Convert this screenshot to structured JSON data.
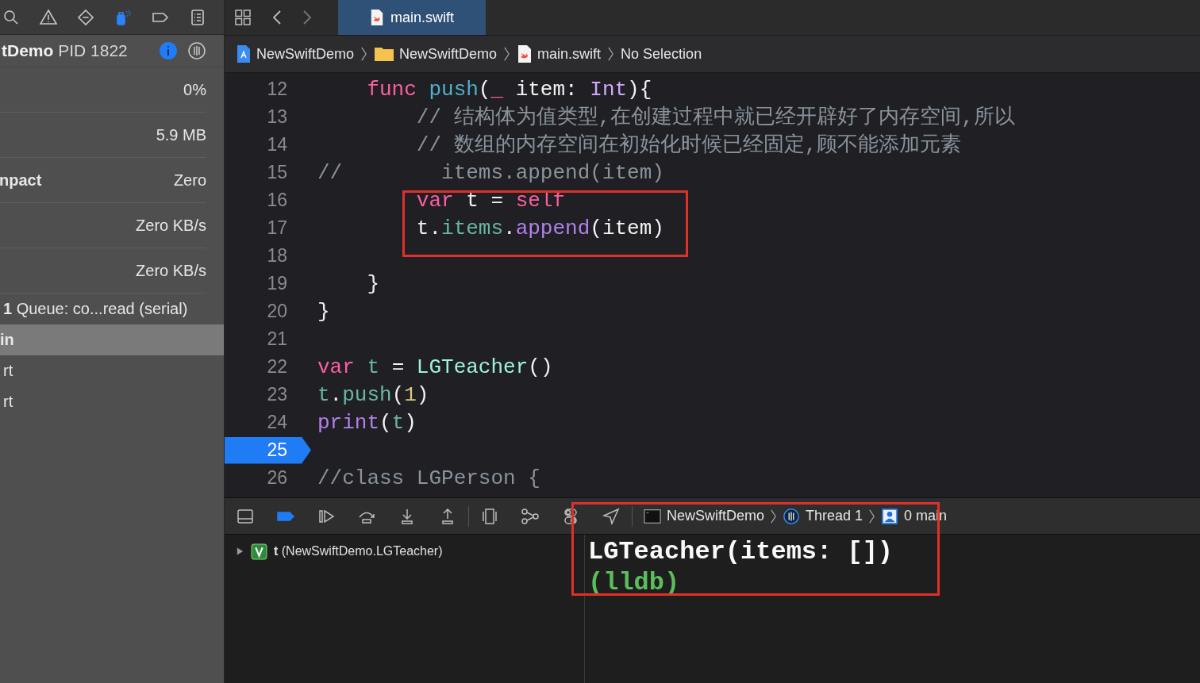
{
  "sidebar": {
    "navigator_tabs": [
      {
        "selected": false
      },
      {
        "selected": false
      },
      {
        "selected": false
      },
      {
        "selected": true
      },
      {
        "selected": false
      },
      {
        "selected": false
      }
    ],
    "process": {
      "name": "tDemo",
      "pid": "PID 1822"
    },
    "gauges": [
      {
        "value": "0%"
      },
      {
        "value": "5.9 MB"
      },
      {
        "label": "npact",
        "value": "Zero"
      },
      {
        "value": "Zero KB/s"
      },
      {
        "value": "Zero KB/s"
      }
    ],
    "threads": [
      {
        "text": "**1** Queue: co...read (serial)",
        "selected": false
      },
      {
        "text": "in",
        "selected": true
      },
      {
        "text": "rt",
        "selected": false
      },
      {
        "text": "rt",
        "selected": false
      }
    ]
  },
  "editor": {
    "tabs": [
      {
        "label": "main.swift",
        "selected": true
      }
    ],
    "breadcrumb": [
      "NewSwiftDemo",
      "NewSwiftDemo",
      "main.swift",
      "No Selection"
    ],
    "lines": [
      {
        "number": "12",
        "tokens": [
          {
            "text": "    func",
            "kind": "keyword"
          },
          {
            "text": " push",
            "kind": "declaration"
          },
          {
            "text": "(",
            "kind": "plain"
          },
          {
            "text": "_",
            "kind": "keyword"
          },
          {
            "text": " item: ",
            "kind": "plain"
          },
          {
            "text": "Int",
            "kind": "type"
          },
          {
            "text": "){",
            "kind": "plain"
          }
        ]
      },
      {
        "number": "13",
        "tokens": [
          {
            "text": "        // 结构体为值类型,在创建过程中就已经开辟好了内存空间,所以",
            "kind": "comment"
          }
        ]
      },
      {
        "number": "14",
        "tokens": [
          {
            "text": "        // 数组的内存空间在初始化时候已经固定,顾不能添加元素",
            "kind": "comment"
          }
        ]
      },
      {
        "number": "15",
        "tokens": [
          {
            "text": "//        items.append(item)",
            "kind": "comment"
          }
        ]
      },
      {
        "number": "16",
        "highlighted": true,
        "tokens": [
          {
            "text": "        var",
            "kind": "keyword"
          },
          {
            "text": " t = ",
            "kind": "plain"
          },
          {
            "text": "self",
            "kind": "keyword"
          }
        ]
      },
      {
        "number": "17",
        "highlighted": true,
        "tokens": [
          {
            "text": "        t.",
            "kind": "plain"
          },
          {
            "text": "items",
            "kind": "project"
          },
          {
            "text": ".",
            "kind": "plain"
          },
          {
            "text": "append",
            "kind": "system"
          },
          {
            "text": "(item)",
            "kind": "plain"
          }
        ]
      },
      {
        "number": "18"
      },
      {
        "number": "19",
        "tokens": [
          {
            "text": "    }",
            "kind": "plain"
          }
        ]
      },
      {
        "number": "20",
        "tokens": [
          {
            "text": "}",
            "kind": "plain"
          }
        ]
      },
      {
        "number": "21"
      },
      {
        "number": "22",
        "tokens": [
          {
            "text": "var",
            "kind": "keyword"
          },
          {
            "text": " t",
            "kind": "project"
          },
          {
            "text": " = ",
            "kind": "plain"
          },
          {
            "text": "LGTeacher",
            "kind": "class"
          },
          {
            "text": "()",
            "kind": "plain"
          }
        ]
      },
      {
        "number": "23",
        "tokens": [
          {
            "text": "t",
            "kind": "project"
          },
          {
            "text": ".",
            "kind": "plain"
          },
          {
            "text": "push",
            "kind": "project"
          },
          {
            "text": "(",
            "kind": "plain"
          },
          {
            "text": "1",
            "kind": "number"
          },
          {
            "text": ")",
            "kind": "plain"
          }
        ]
      },
      {
        "number": "24",
        "tokens": [
          {
            "text": "print",
            "kind": "system"
          },
          {
            "text": "(",
            "kind": "plain"
          },
          {
            "text": "t",
            "kind": "project"
          },
          {
            "text": ")",
            "kind": "plain"
          }
        ]
      },
      {
        "number": "25",
        "current": true
      },
      {
        "number": "26",
        "tokens": [
          {
            "text": "//class LGPerson {",
            "kind": "comment"
          }
        ]
      }
    ]
  },
  "debug_bar": {
    "breakpoints_active": true,
    "path": [
      "NewSwiftDemo",
      "Thread 1",
      "0 main"
    ]
  },
  "variables": [
    {
      "text": "**t** (NewSwiftDemo.LGTeacher)",
      "expanded": false
    }
  ],
  "console": {
    "highlighted": true,
    "lines": [
      {
        "text": "LGTeacher(items: [])",
        "kind": "output"
      },
      {
        "text": "(lldb)",
        "kind": "prompt"
      }
    ]
  }
}
